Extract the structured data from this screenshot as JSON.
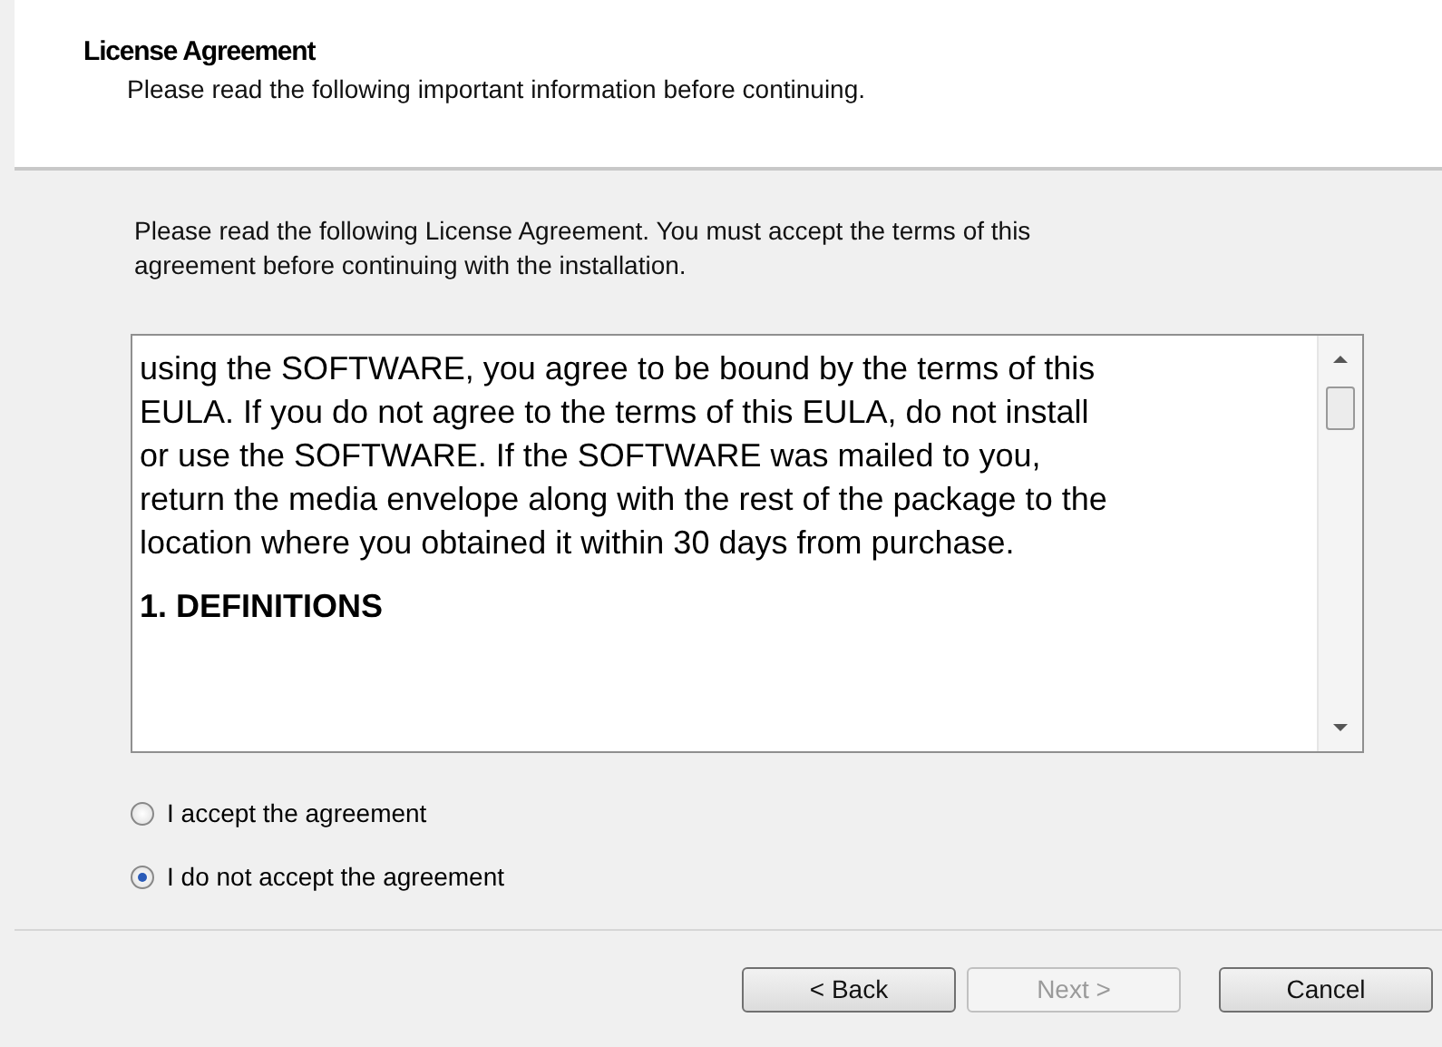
{
  "header": {
    "title": "License Agreement",
    "subtitle": "Please read the following important information before continuing."
  },
  "instruction": "Please read the following License Agreement. You must accept the terms of this agreement before continuing with the installation.",
  "license_text": [
    {
      "kind": "paragraph",
      "lines": [
        "using the SOFTWARE, you agree to be bound by the terms of this",
        "EULA. If you do not agree to the terms of this EULA, do not install",
        "or use the SOFTWARE. If the SOFTWARE was mailed to you,",
        "return the media envelope along with the rest of the package to the",
        "location where you obtained it within 30 days from purchase."
      ]
    },
    {
      "kind": "heading",
      "lines": [
        "1. DEFINITIONS"
      ]
    }
  ],
  "options": [
    {
      "label": "I accept the agreement",
      "selected": false
    },
    {
      "label": "I do not accept the agreement",
      "selected": true
    }
  ],
  "buttons": [
    {
      "label": "< Back",
      "disabled": false
    },
    {
      "label": "Next >",
      "disabled": true
    },
    {
      "label": "Cancel",
      "disabled": false
    }
  ]
}
